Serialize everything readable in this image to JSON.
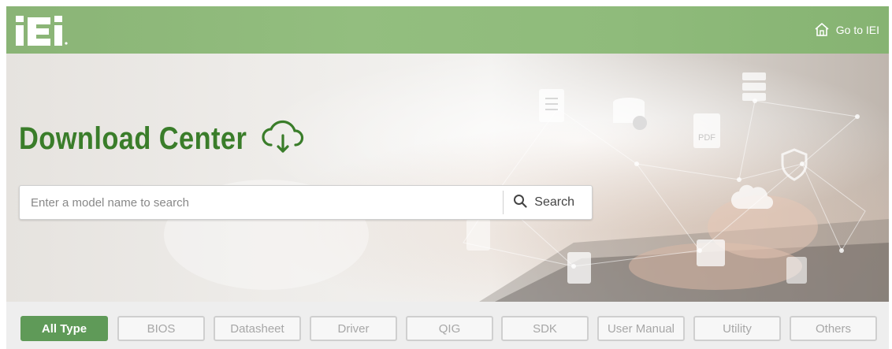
{
  "header": {
    "logo_icon": "iei-logo",
    "goto_label": "Go to IEI",
    "goto_icon": "home-icon"
  },
  "hero": {
    "title": "Download Center",
    "title_icon": "cloud-download-icon",
    "search": {
      "placeholder": "Enter a model name to search",
      "value": "",
      "button_label": "Search",
      "button_icon": "search-icon"
    }
  },
  "filters": {
    "tabs": [
      {
        "label": "All Type",
        "active": true
      },
      {
        "label": "BIOS",
        "active": false
      },
      {
        "label": "Datasheet",
        "active": false
      },
      {
        "label": "Driver",
        "active": false
      },
      {
        "label": "QIG",
        "active": false
      },
      {
        "label": "SDK",
        "active": false
      },
      {
        "label": "User Manual",
        "active": false
      },
      {
        "label": "Utility",
        "active": false
      },
      {
        "label": "Others",
        "active": false
      }
    ]
  },
  "colors": {
    "header_green": "#8fbb7b",
    "title_green": "#3a7d2a",
    "active_tab": "#5f9a58"
  }
}
